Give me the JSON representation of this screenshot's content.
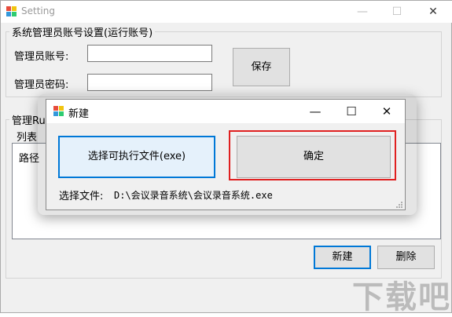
{
  "main_window": {
    "title": "Setting",
    "controls": {
      "minimize": "—",
      "maximize": "☐",
      "close": "✕"
    },
    "admin_group": {
      "label": "系统管理员账号设置(运行账号)",
      "account_label": "管理员账号:",
      "account_value": "",
      "password_label": "管理员密码:",
      "password_value": "",
      "save_button": "保存"
    },
    "run_group": {
      "label": "管理Run",
      "list_label": "列表",
      "column_path": "路径",
      "new_button": "新建",
      "delete_button": "删除"
    }
  },
  "dialog": {
    "title": "新建",
    "controls": {
      "minimize": "—",
      "maximize": "☐",
      "close": "✕"
    },
    "select_exe_button": "选择可执行文件(exe)",
    "confirm_button": "确定",
    "selected_file_label": "选择文件:",
    "selected_file_value": "D:\\会议录音系统\\会议录音系统.exe"
  },
  "watermark": {
    "text": "下载吧"
  },
  "colors": {
    "highlight": "#e02020",
    "focus": "#0078d7"
  }
}
